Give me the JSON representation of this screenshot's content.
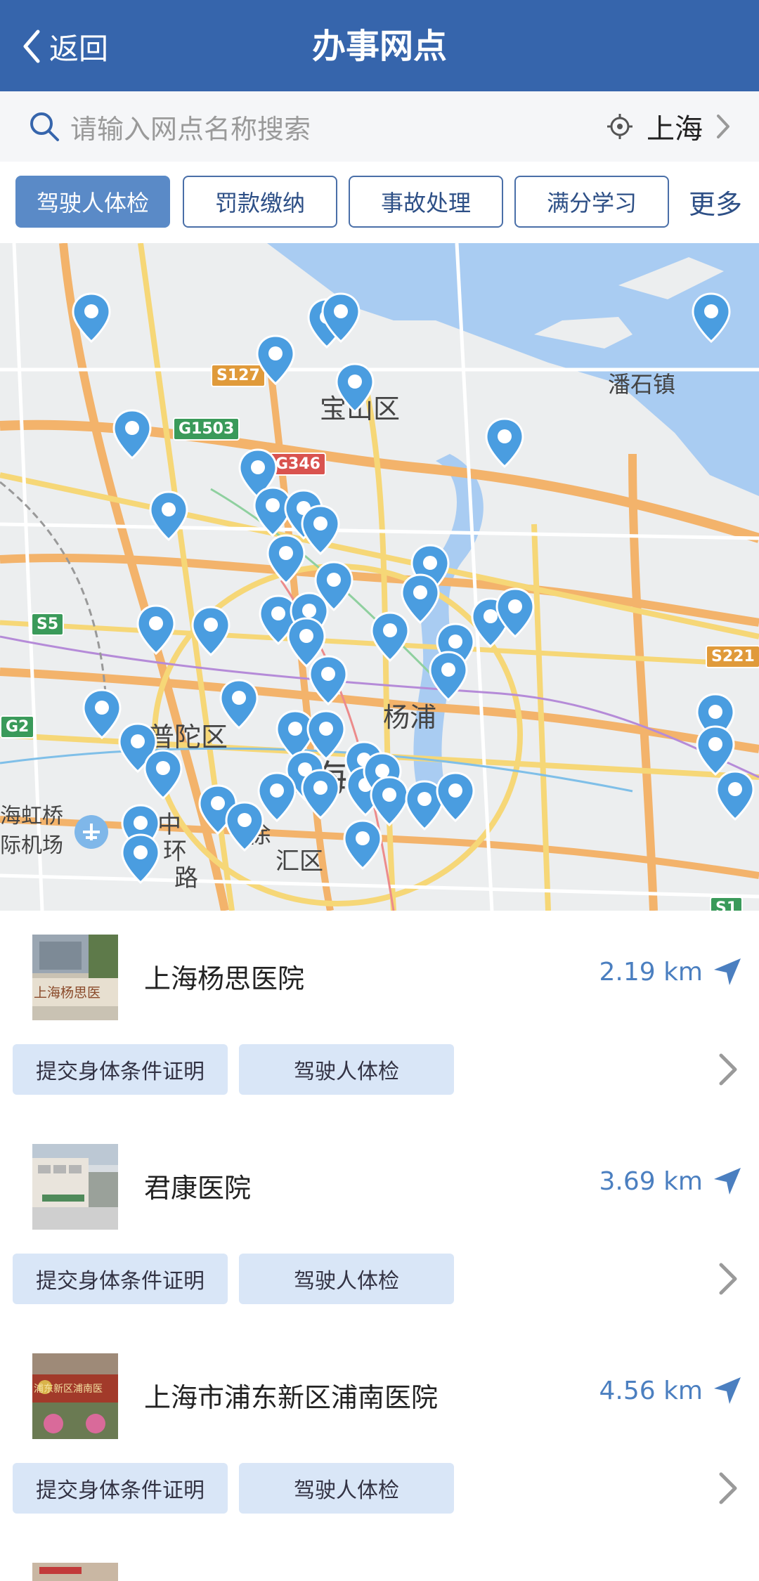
{
  "header": {
    "back_label": "返回",
    "title": "办事网点"
  },
  "search": {
    "placeholder": "请输入网点名称搜索",
    "city": "上海"
  },
  "tabs": [
    {
      "label": "驾驶人体检",
      "active": true
    },
    {
      "label": "罚款缴纳",
      "active": false
    },
    {
      "label": "事故处理",
      "active": false
    },
    {
      "label": "满分学习",
      "active": false
    }
  ],
  "tabs_more": "更多",
  "map": {
    "place_labels": [
      "宝山区",
      "潘石镇",
      "普陀区",
      "杨浦",
      "上海",
      "海虹桥",
      "际机场",
      "中",
      "环",
      "路",
      "徐",
      "汇区"
    ],
    "road_badges": [
      "S127",
      "G1503",
      "G346",
      "S5",
      "S221",
      "G2",
      "S1"
    ],
    "pin_color": "#4a9de0"
  },
  "places": [
    {
      "name": "上海杨思医院",
      "distance": "2.19 km",
      "thumb_text": "上海杨思医",
      "tags": [
        "提交身体条件证明",
        "驾驶人体检"
      ]
    },
    {
      "name": "君康医院",
      "distance": "3.69 km",
      "thumb_text": "",
      "tags": [
        "提交身体条件证明",
        "驾驶人体检"
      ]
    },
    {
      "name": "上海市浦东新区浦南医院",
      "distance": "4.56 km",
      "thumb_text": "浦东新区浦南医",
      "tags": [
        "提交身体条件证明",
        "驾驶人体检"
      ]
    }
  ]
}
